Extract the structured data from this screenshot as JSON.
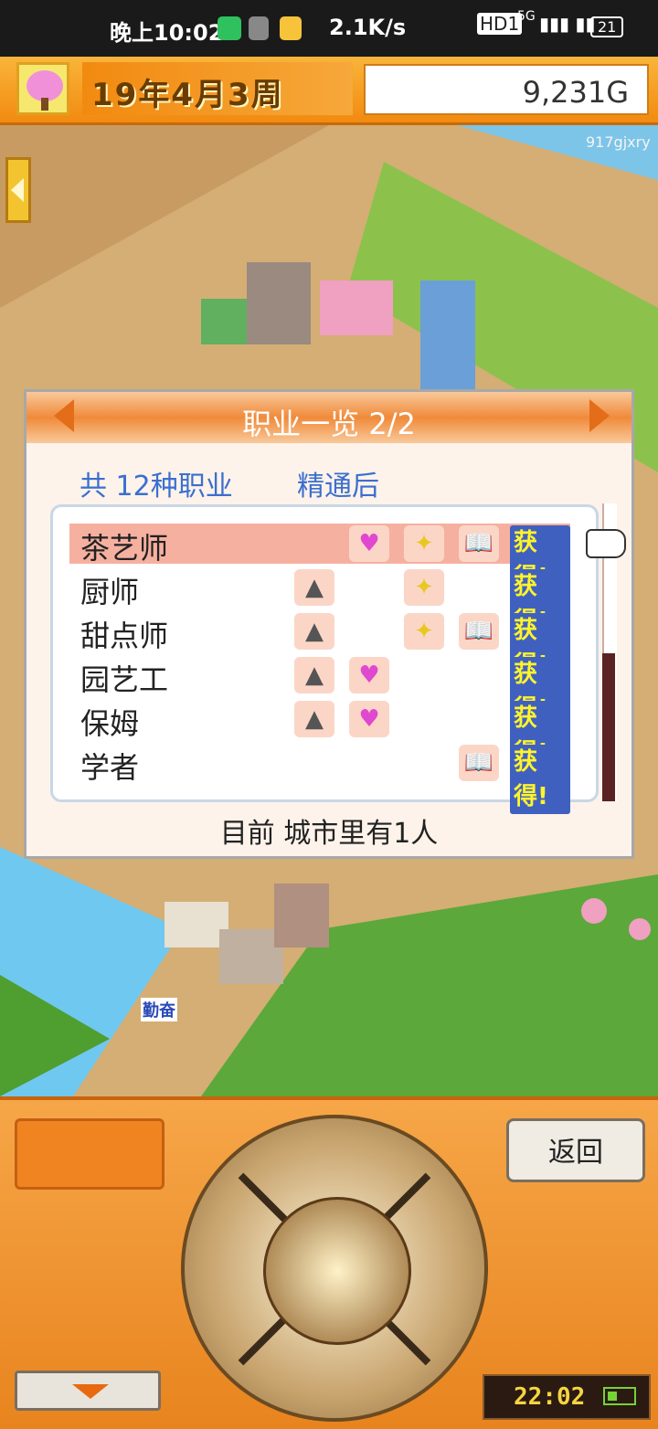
{
  "status_bar": {
    "time": "晚上10:02",
    "net_speed": "2.1K/s",
    "hd": "HD1",
    "signal": "5G",
    "battery": "21"
  },
  "top_bar": {
    "date": "19年4月3周",
    "money": "9,231G"
  },
  "watermark": "917gjxry",
  "dialog": {
    "title": "职业一览 2/2",
    "summary": "共 12种职业",
    "mastered_label": "精通后",
    "footer": "目前 城市里有1人",
    "get_label": "获得!",
    "jobs": [
      {
        "name": "茶艺师",
        "icons": [
          "heart-icon",
          "sparkle-icon",
          "book-icon"
        ]
      },
      {
        "name": "厨师",
        "icons": [
          "onigiri-icon",
          "sparkle-icon"
        ]
      },
      {
        "name": "甜点师",
        "icons": [
          "onigiri-icon",
          "sparkle-icon",
          "book-icon"
        ]
      },
      {
        "name": "园艺工",
        "icons": [
          "onigiri-icon",
          "heart-icon"
        ]
      },
      {
        "name": "保姆",
        "icons": [
          "onigiri-icon",
          "heart-icon"
        ]
      },
      {
        "name": "学者",
        "icons": [
          "book-icon"
        ]
      }
    ]
  },
  "controls": {
    "back_label": "返回",
    "clock": "22:02"
  },
  "map": {
    "speech_label": "勤奋"
  },
  "colors": {
    "accent": "#f28a10",
    "title_bar": "#f08a3a",
    "highlight_row": "#f6b0a0",
    "blue_text": "#3b6fd0"
  }
}
